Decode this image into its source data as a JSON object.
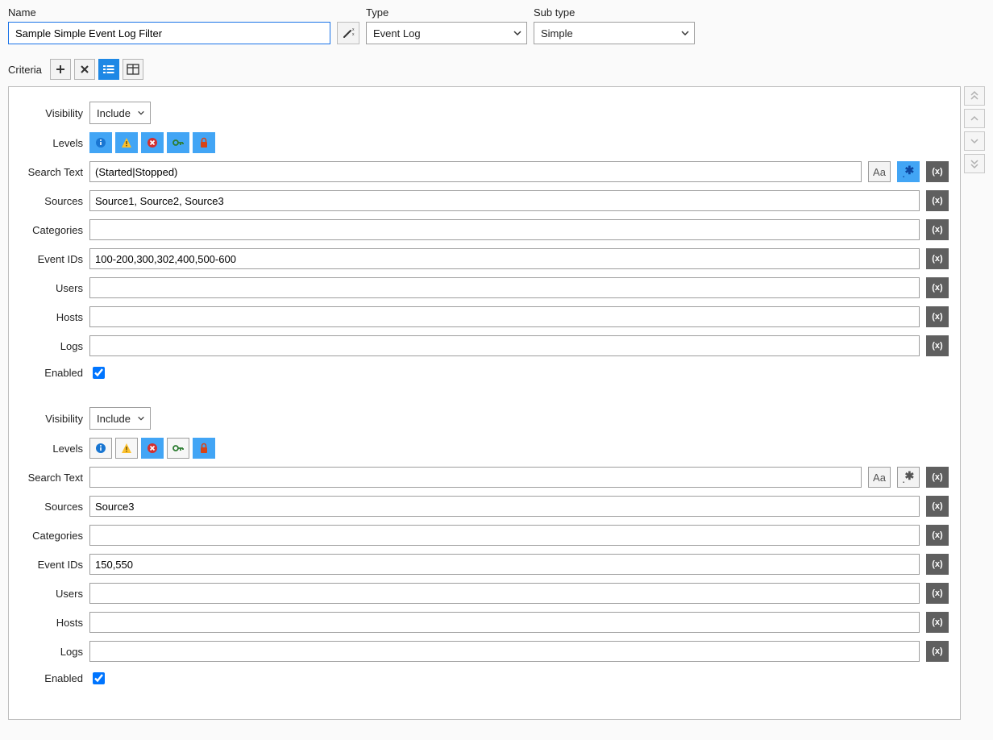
{
  "header": {
    "name_label": "Name",
    "name_value": "Sample Simple Event Log Filter",
    "type_label": "Type",
    "type_value": "Event Log",
    "subtype_label": "Sub type",
    "subtype_value": "Simple"
  },
  "criteria_label": "Criteria",
  "labels": {
    "visibility": "Visibility",
    "levels": "Levels",
    "search_text": "Search Text",
    "sources": "Sources",
    "categories": "Categories",
    "event_ids": "Event IDs",
    "users": "Users",
    "hosts": "Hosts",
    "logs": "Logs",
    "enabled": "Enabled"
  },
  "blocks": [
    {
      "visibility": "Include",
      "levels_selected": [
        true,
        true,
        true,
        true,
        true
      ],
      "search_text": "(Started|Stopped)",
      "case_sensitive_selected": false,
      "regex_selected": true,
      "sources": "Source1, Source2, Source3",
      "categories": "",
      "event_ids": "100-200,300,302,400,500-600",
      "users": "",
      "hosts": "",
      "logs": "",
      "enabled": true
    },
    {
      "visibility": "Include",
      "levels_selected": [
        false,
        false,
        true,
        false,
        true
      ],
      "search_text": "",
      "case_sensitive_selected": false,
      "regex_selected": false,
      "sources": "Source3",
      "categories": "",
      "event_ids": "150,550",
      "users": "",
      "hosts": "",
      "logs": "",
      "enabled": true
    }
  ],
  "icons": {
    "wand": "magic-wand-icon",
    "plus": "plus-icon",
    "cross": "cross-icon",
    "list": "list-icon",
    "grid": "grid-icon",
    "info": "info-icon",
    "warn": "warning-icon",
    "error": "error-icon",
    "key": "key-icon",
    "lock": "lock-icon",
    "case_sensitive_label": "Aa",
    "regex_label": ".*",
    "var": "variable-icon",
    "chevron_down": "chevron-down-icon",
    "dbl_chevron_up": "double-chevron-up-icon",
    "chevron_up": "chevron-up-icon",
    "dbl_chevron_down": "double-chevron-down-icon"
  }
}
